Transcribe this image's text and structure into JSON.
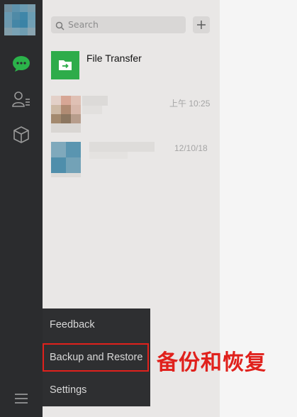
{
  "search": {
    "placeholder": "Search"
  },
  "chats": [
    {
      "name": "File Transfer",
      "time": ""
    },
    {
      "name": "",
      "time": "上午 10:25"
    },
    {
      "name": "",
      "time": "12/10/18"
    }
  ],
  "menu": {
    "items": [
      "Feedback",
      "Backup and Restore",
      "Settings"
    ]
  },
  "annotation": {
    "label": "备份和恢复"
  },
  "colors": {
    "rail": "#2b2c2e",
    "list": "#e9e7e6",
    "accent_green": "#2eac4a",
    "annotation_red": "#e0211c",
    "popup": "#2e2f31"
  },
  "icons": {
    "rail": [
      "chat-icon",
      "contacts-icon",
      "cube-icon",
      "menu-icon"
    ],
    "list": [
      "search-icon",
      "plus-icon",
      "file-transfer-icon"
    ]
  }
}
